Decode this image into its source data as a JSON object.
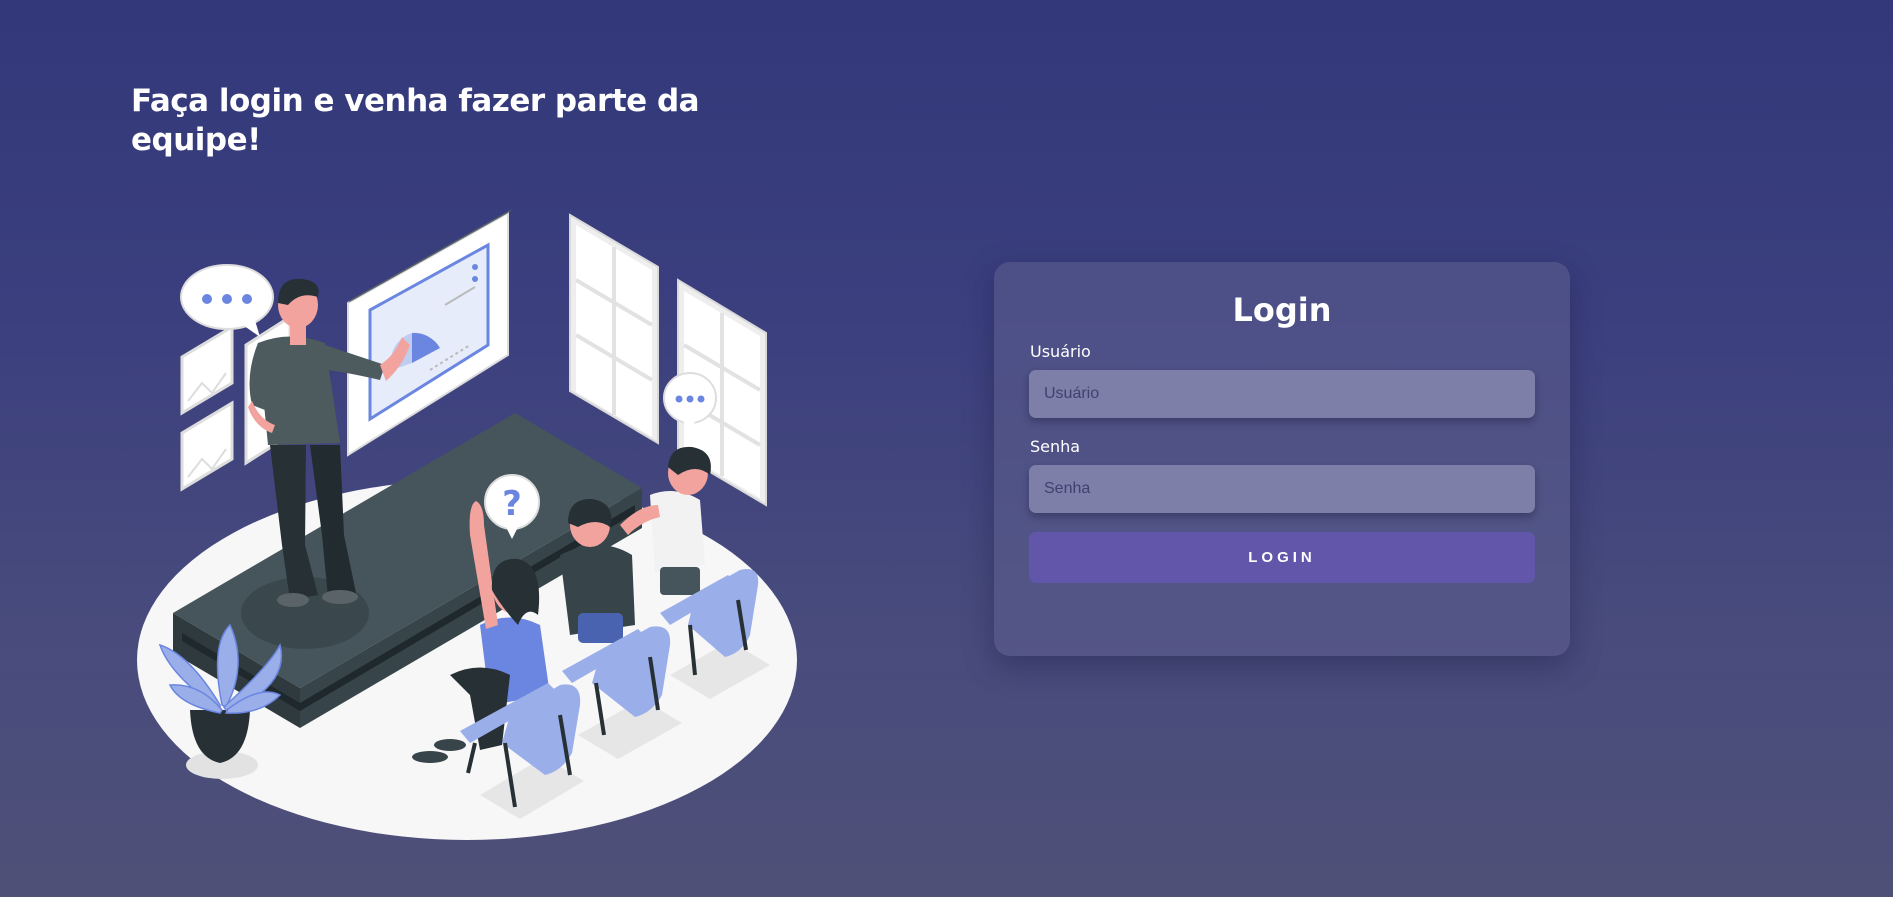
{
  "hero": {
    "headline": "Faça login e venha fazer parte da equipe!"
  },
  "illustration": {
    "name": "classroom-presentation-illustration",
    "bubble_question_mark": "?"
  },
  "login": {
    "title": "Login",
    "username": {
      "label": "Usuário",
      "placeholder": "Usuário",
      "value": ""
    },
    "password": {
      "label": "Senha",
      "placeholder": "Senha",
      "value": ""
    },
    "button_label": "LOGIN"
  },
  "colors": {
    "background_top": "#32387a",
    "background_bottom": "#4f5078",
    "card": "#54568a",
    "input": "#7d7fa8",
    "button": "#6256aa",
    "accent_blue": "#6b86e0",
    "chair": "#9aaeea"
  }
}
